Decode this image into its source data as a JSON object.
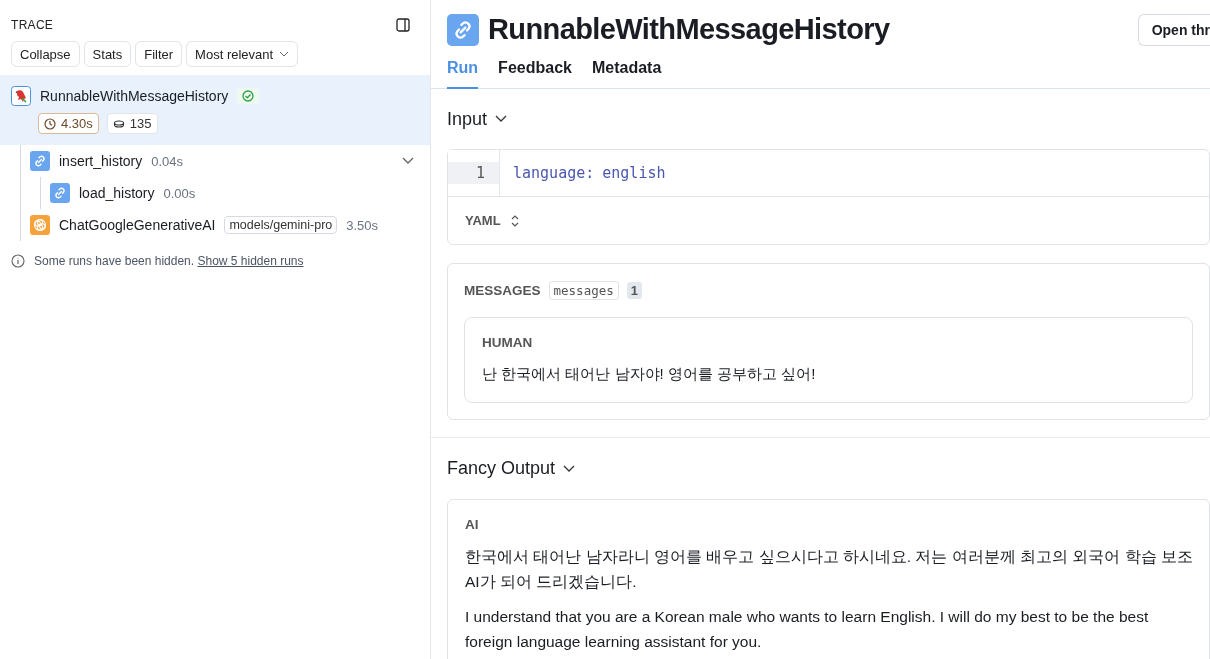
{
  "trace": {
    "title": "TRACE",
    "buttons": [
      {
        "label": "Collapse",
        "kind": "button"
      },
      {
        "label": "Stats",
        "kind": "button"
      },
      {
        "label": "Filter",
        "kind": "button"
      },
      {
        "label": "Most relevant",
        "kind": "dropdown"
      }
    ],
    "runs": [
      {
        "name": "RunnableWithMessageHistory",
        "kind": "parrot",
        "selected": true,
        "success": true,
        "latency": "4.30s",
        "tokens": "135",
        "children": [
          {
            "name": "insert_history",
            "kind": "chain",
            "selected": false,
            "time": "0.04s",
            "expanded": true,
            "children": [
              {
                "name": "load_history",
                "kind": "chain",
                "selected": false,
                "time": "0.00s"
              }
            ]
          },
          {
            "name": "ChatGoogleGenerativeAI",
            "kind": "llm",
            "selected": false,
            "tag": "models/gemini-pro",
            "time": "3.50s"
          }
        ]
      }
    ],
    "note": {
      "text": "Some runs have been hidden.",
      "link": "Show 5 hidden runs"
    }
  },
  "run": {
    "kind": "chain",
    "title": "RunnableWithMessageHistory",
    "action": "Open thr",
    "tabs": [
      {
        "label": "Run",
        "selected": true
      },
      {
        "label": "Feedback",
        "selected": false
      },
      {
        "label": "Metadata",
        "selected": false
      }
    ],
    "input": {
      "heading": "Input",
      "expanded": true,
      "lines": [
        {
          "number": "1",
          "key": "language:",
          "value": "english"
        }
      ],
      "format": "YAML"
    },
    "messages": {
      "heading": "MESSAGES",
      "field": "messages",
      "count": "1",
      "items": [
        {
          "role": "HUMAN",
          "text": "난 한국에서 태어난 남자야! 영어를 공부하고 싶어!"
        }
      ]
    },
    "output": {
      "heading": "Fancy Output",
      "expanded": true,
      "items": [
        {
          "role": "AI",
          "paragraphs": [
            "한국에서 태어난 남자라니 영어를 배우고 싶으시다고 하시네요. 저는 여러분께 최고의 외국어 학습 보조 AI가 되어 드리겠습니다.",
            "I understand that you are a Korean male who wants to learn English. I will do my best to be the best foreign language learning assistant for you."
          ]
        }
      ]
    }
  }
}
